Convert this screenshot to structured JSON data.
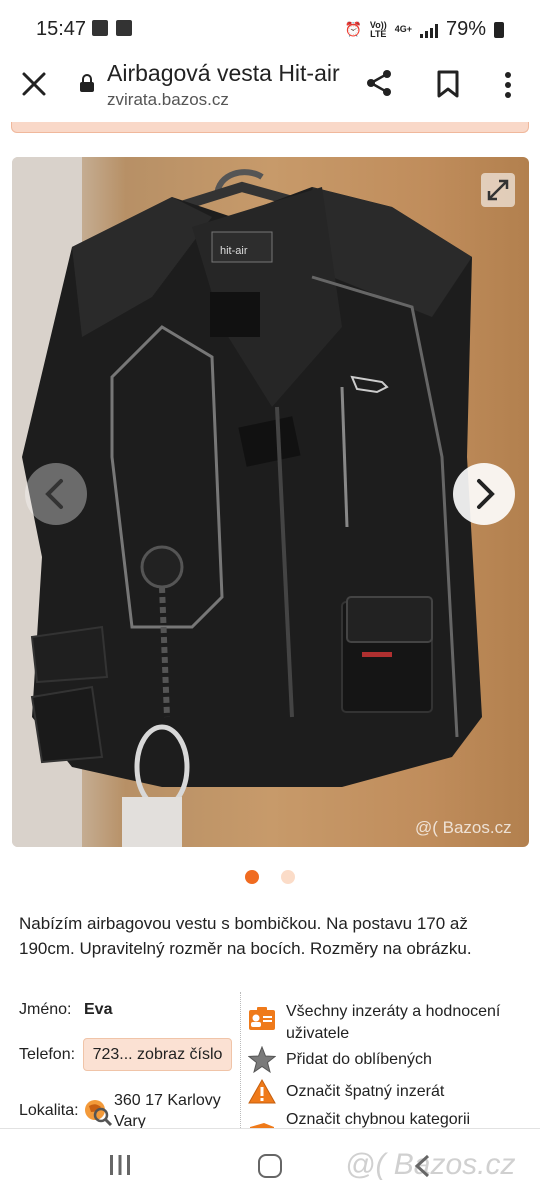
{
  "status_bar": {
    "time": "15:47",
    "network_top": "Vo))",
    "network_bottom": "LTE",
    "network_type": "4G+",
    "battery": "79%"
  },
  "toolbar": {
    "title": "Airbagová vesta Hit-air",
    "domain": "zvirata.bazos.cz"
  },
  "photo": {
    "watermark": "@( Bazos.cz",
    "pagination": {
      "count": 2,
      "active": 0
    }
  },
  "description": "Nabízím airbagovou vestu s bombičkou. Na postavu 170 až 190cm. Upravitelný rozměr na bocích. Rozměry na obrázku.",
  "seller": {
    "name_label": "Jméno:",
    "name_value": "Eva",
    "phone_label": "Telefon:",
    "phone_value": "723... zobraz číslo",
    "location_label": "Lokalita:",
    "location_value": "360 17 Karlovy Vary"
  },
  "actions": [
    {
      "label": "Všechny inzeráty a hodnocení uživatele",
      "icon": "user-card-icon"
    },
    {
      "label": "Přidat do oblíbených",
      "icon": "star-icon"
    },
    {
      "label": "Označit špatný inzerát",
      "icon": "warning-icon"
    },
    {
      "label": "Označit chybnou kategorii",
      "icon": "truck-icon"
    }
  ],
  "bottom_watermark": "@( Bazos.cz",
  "colors": {
    "accent": "#f06b20",
    "accent_light": "#fbe1d3"
  }
}
